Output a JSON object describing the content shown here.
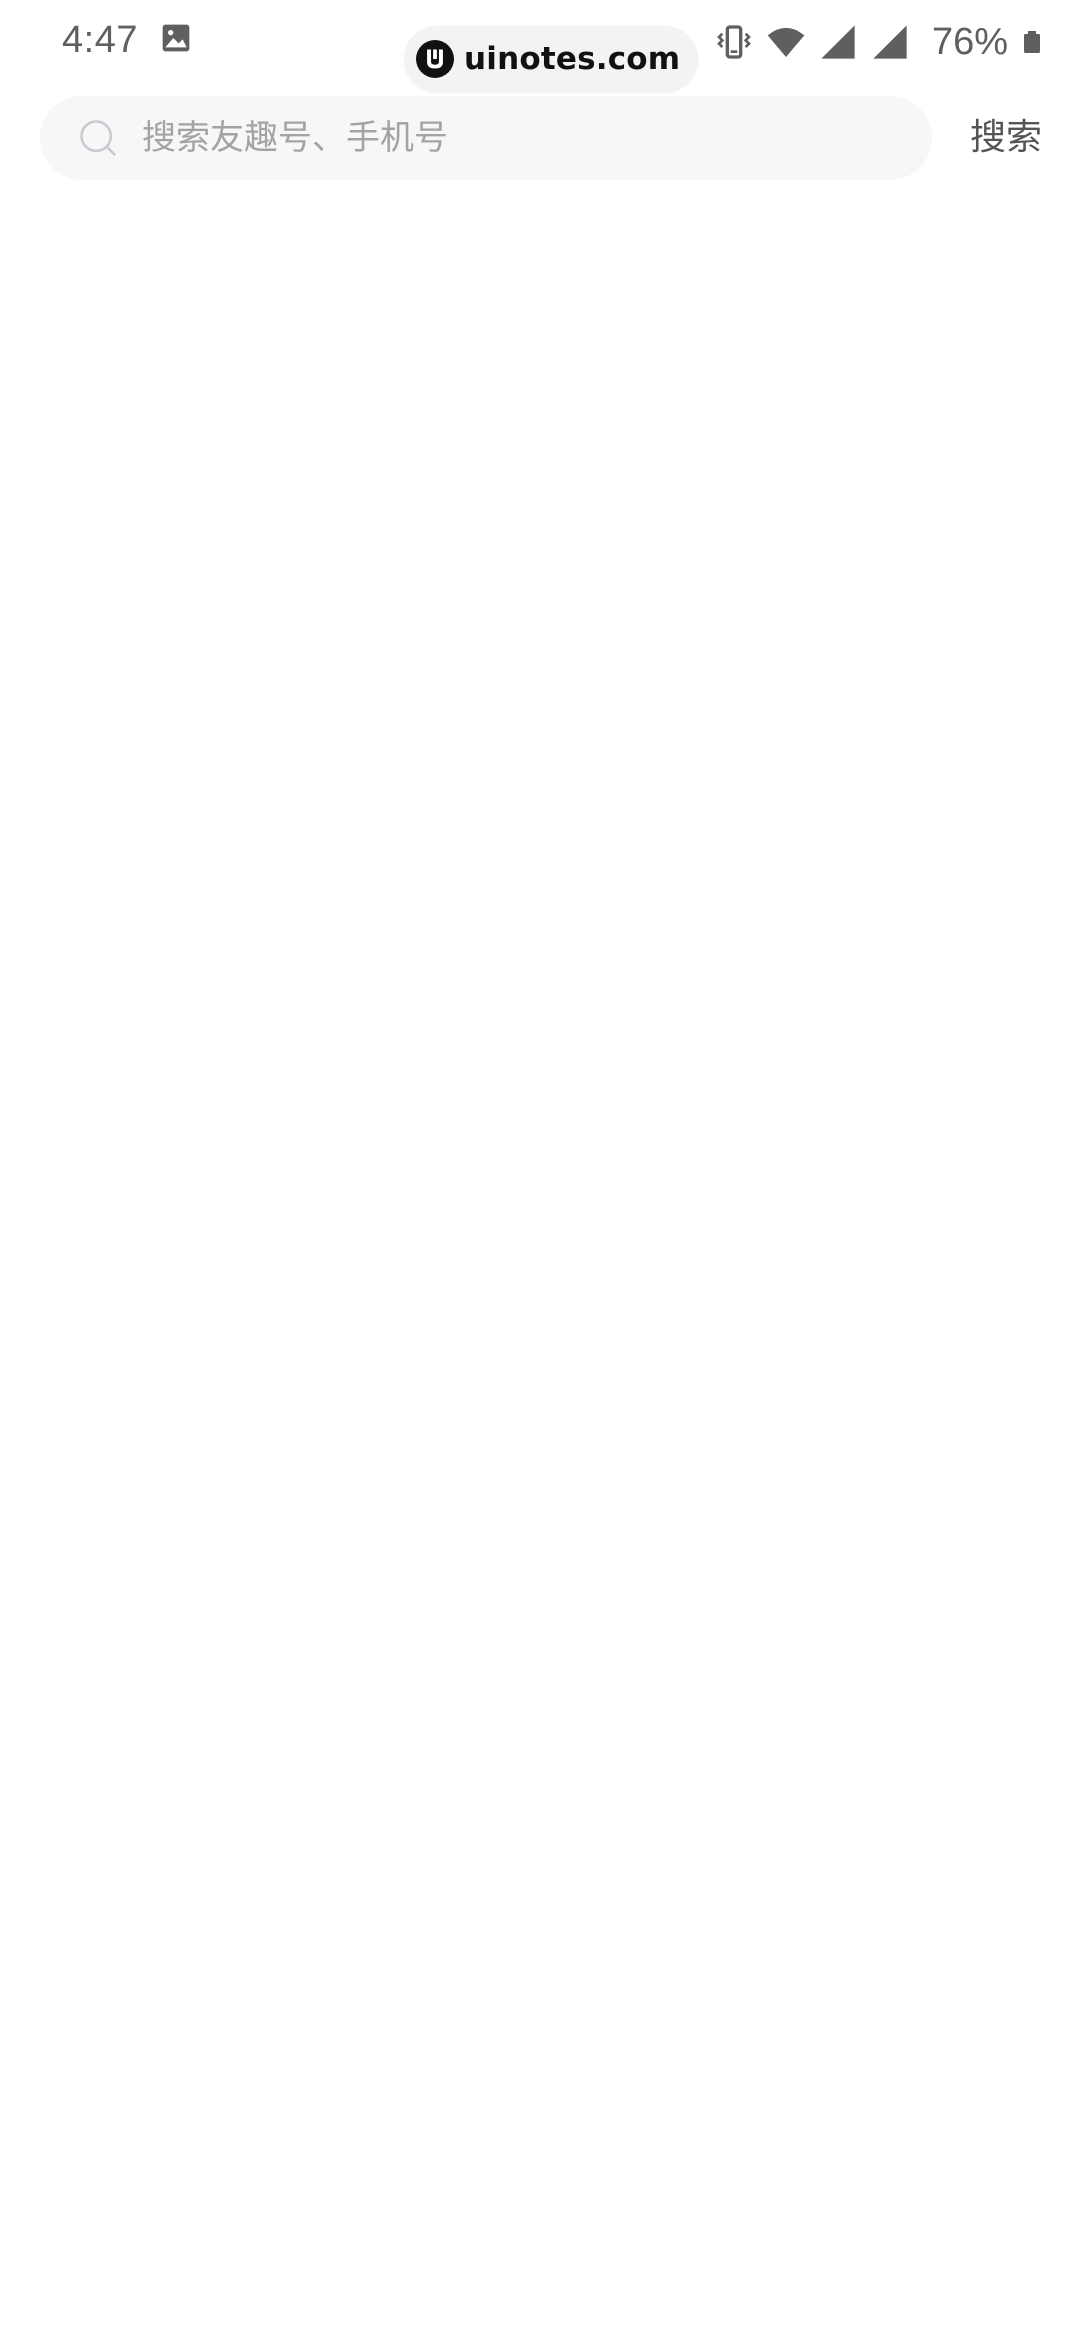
{
  "status_bar": {
    "time": "4:47",
    "battery": "76%",
    "icons": [
      "image-icon",
      "vibrate-icon",
      "wifi-icon",
      "signal-icon",
      "signal-icon",
      "battery-icon"
    ]
  },
  "watermark": {
    "text": "uinotes.com"
  },
  "search": {
    "placeholder": "搜索友趣号、手机号",
    "value": "",
    "button_label": "搜索"
  },
  "colors": {
    "status_text": "#5f5f5f",
    "search_bg": "#f7f7f7",
    "placeholder": "#a3a3a3",
    "button_text": "#555555",
    "search_icon": "#c9c9d2"
  }
}
